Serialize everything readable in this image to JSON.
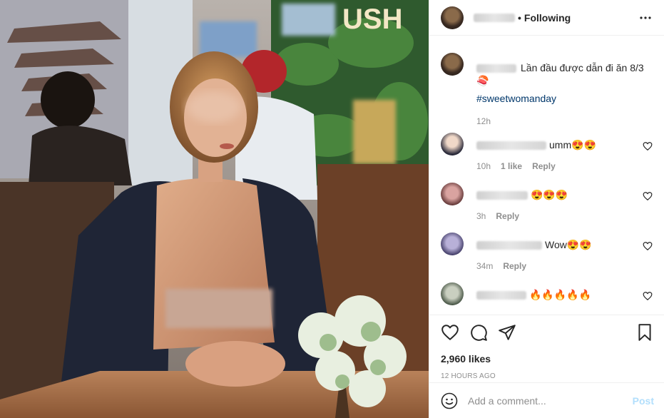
{
  "post_header": {
    "separator": "•",
    "follow_status": "Following",
    "more_icon": "more-horizontal-icon"
  },
  "caption": {
    "text": "Lần đầu được dẫn đi ăn 8/3 🍣",
    "hashtag": "#sweetwomanday",
    "time": "12h"
  },
  "comments": [
    {
      "text": "umm😍😍",
      "time": "10h",
      "likes": "1 like",
      "reply": "Reply"
    },
    {
      "text": "😍😍😍",
      "time": "3h",
      "likes": "",
      "reply": "Reply"
    },
    {
      "text": "Wow😍😍",
      "time": "34m",
      "likes": "",
      "reply": "Reply"
    },
    {
      "text": "🔥🔥🔥🔥🔥",
      "time": "",
      "likes": "",
      "reply": ""
    }
  ],
  "actions": {
    "like_icon": "heart-icon",
    "comment_icon": "comment-icon",
    "share_icon": "send-icon",
    "save_icon": "bookmark-icon"
  },
  "likes_count": "2,960 likes",
  "time_ago": "12 HOURS AGO",
  "add_comment": {
    "placeholder": "Add a comment...",
    "post_label": "Post",
    "emoji_icon": "smiley-icon"
  },
  "colors": {
    "link": "#00376b",
    "muted": "#8e8e8e",
    "post_disabled": "#b2dffc",
    "border": "#efefef"
  }
}
